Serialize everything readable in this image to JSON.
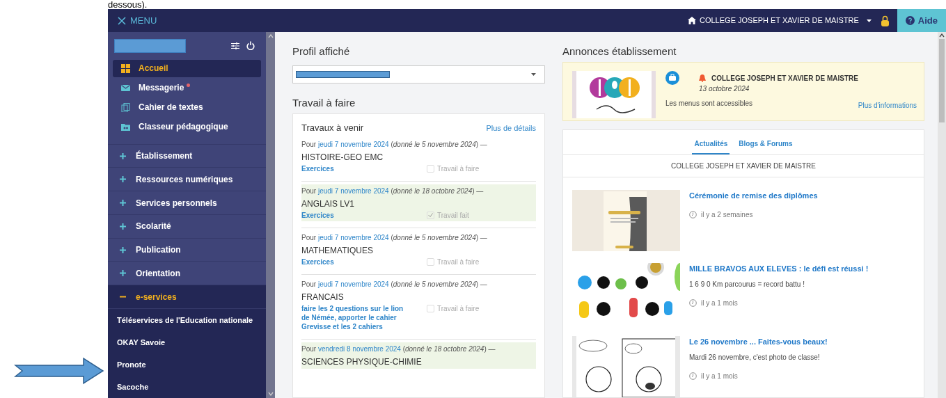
{
  "document_text": "dessous).",
  "topbar": {
    "menu_label": "MENU",
    "school": "COLLEGE JOSEPH ET XAVIER DE MAISTRE",
    "help": "Aide"
  },
  "sidebar": {
    "quick_links": [
      {
        "label": "Accueil",
        "selected": true,
        "notification": false
      },
      {
        "label": "Messagerie",
        "selected": false,
        "notification": true
      },
      {
        "label": "Cahier de textes",
        "selected": false,
        "notification": false
      },
      {
        "label": "Classeur pédagogique",
        "selected": false,
        "notification": false
      }
    ],
    "sections": [
      {
        "label": "Établissement",
        "expanded": false
      },
      {
        "label": "Ressources numériques",
        "expanded": false
      },
      {
        "label": "Services personnels",
        "expanded": false
      },
      {
        "label": "Scolarité",
        "expanded": false
      },
      {
        "label": "Publication",
        "expanded": false
      },
      {
        "label": "Orientation",
        "expanded": false
      },
      {
        "label": "e-services",
        "expanded": true,
        "children": [
          {
            "label": "Téléservices de l'Education nationale"
          },
          {
            "label": "OKAY Savoie"
          },
          {
            "label": "Pronote"
          },
          {
            "label": "Sacoche"
          }
        ]
      }
    ]
  },
  "profile": {
    "title": "Profil affiché"
  },
  "homework": {
    "title": "Travail à faire",
    "subtitle": "Travaux à venir",
    "more_link": "Plus de détails",
    "items": [
      {
        "prefix": "Pour",
        "due_date": "jeudi 7 novembre 2024",
        "given": "(*donné le 5 novembre 2024*) —",
        "subject": "HISTOIRE-GEO EMC",
        "task": "Exercices",
        "done": false,
        "status": "Travail à faire"
      },
      {
        "prefix": "Pour",
        "due_date": "jeudi 7 novembre 2024",
        "given": "(*donné le 18 octobre 2024*) —",
        "subject": "ANGLAIS LV1",
        "task": "Exercices",
        "done": true,
        "status": "Travail fait"
      },
      {
        "prefix": "Pour",
        "due_date": "jeudi 7 novembre 2024",
        "given": "(*donné le 5 novembre 2024*) —",
        "subject": "MATHEMATIQUES",
        "task": "Exercices",
        "done": false,
        "status": "Travail à faire"
      },
      {
        "prefix": "Pour",
        "due_date": "jeudi 7 novembre 2024",
        "given": "(*donné le 5 novembre 2024*) —",
        "subject": "FRANCAIS",
        "task": "faire les 2 questions sur le lion de Némée, apporter le cahier Grevisse et les 2 cahiers",
        "done": false,
        "status": "Travail à faire"
      },
      {
        "prefix": "Pour",
        "due_date": "vendredi 8 novembre 2024",
        "given": "(*donné le 18 octobre 2024*) —",
        "subject": "SCIENCES PHYSIQUE-CHIMIE",
        "done": true
      }
    ]
  },
  "announcements": {
    "title": "Annonces établissement",
    "card": {
      "author": "COLLEGE JOSEPH ET XAVIER DE MAISTRE",
      "date": "13 octobre 2024",
      "text": "Les menus sont accessibles",
      "more_link": "Plus d'informations"
    }
  },
  "news": {
    "tabs": [
      {
        "label": "Actualités",
        "selected": true
      },
      {
        "label": "Blogs & Forums",
        "selected": false
      }
    ],
    "source": "COLLEGE JOSEPH ET XAVIER DE MAISTRE",
    "items": [
      {
        "title": "Cérémonie de remise des diplômes",
        "time": "il y a 2 semaines"
      },
      {
        "title": "MILLE BRAVOS AUX ELEVES : le défi est réussi !",
        "summary": "1 6 9 0 Km parcourus = record battu !",
        "time": "il y a 1 mois"
      },
      {
        "title": "Le 26 novembre ... Faites-vous beaux!",
        "summary": "Mardi 26 novembre, c'est photo de classe!",
        "time": "il y a 1 mois"
      }
    ]
  }
}
